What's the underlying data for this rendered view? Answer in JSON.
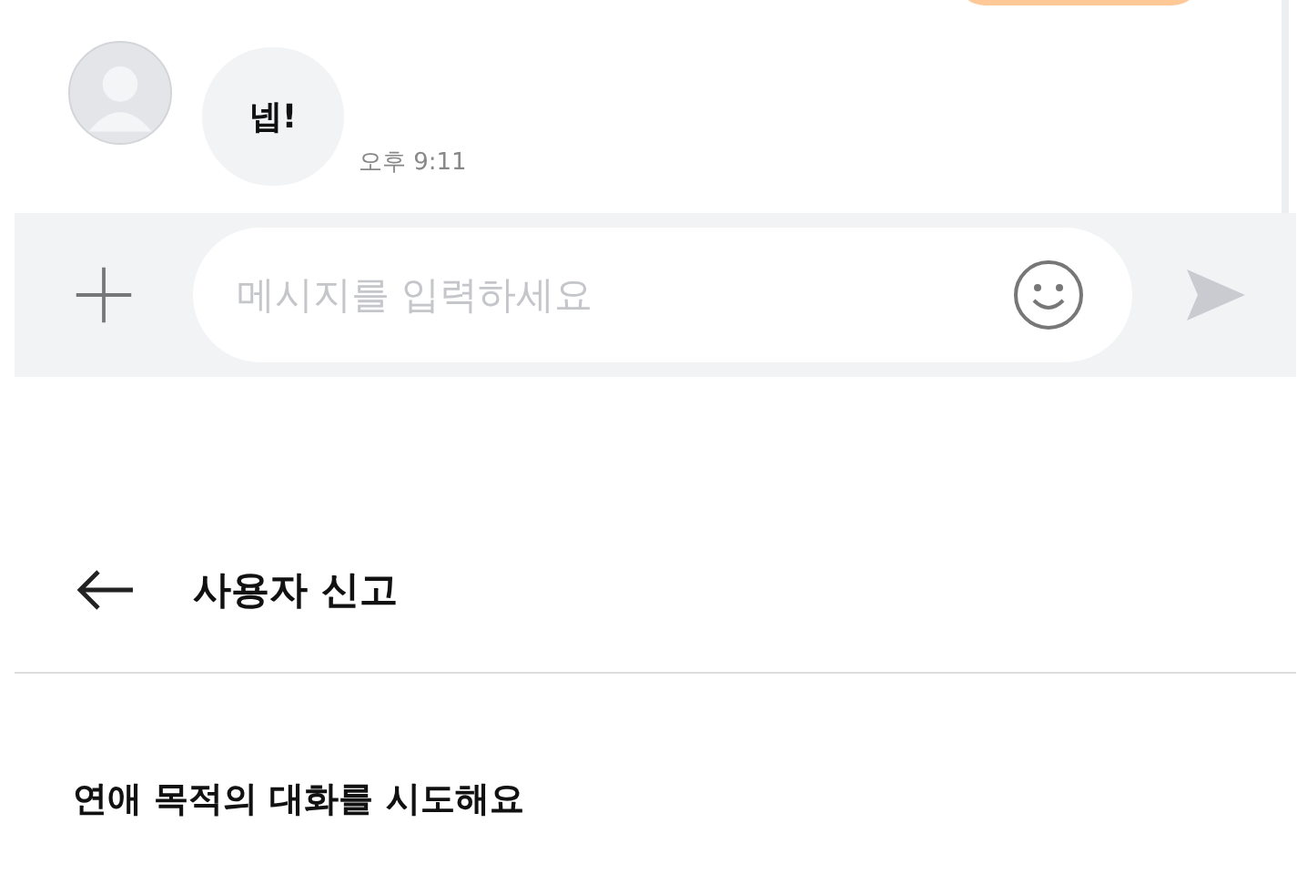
{
  "chat": {
    "messages": [
      {
        "text": "넵!",
        "time": "오후 9:11"
      }
    ]
  },
  "composer": {
    "placeholder": "메시지를 입력하세요"
  },
  "report": {
    "title": "사용자 신고",
    "reason": "연애 목적의 대화를 시도해요"
  }
}
